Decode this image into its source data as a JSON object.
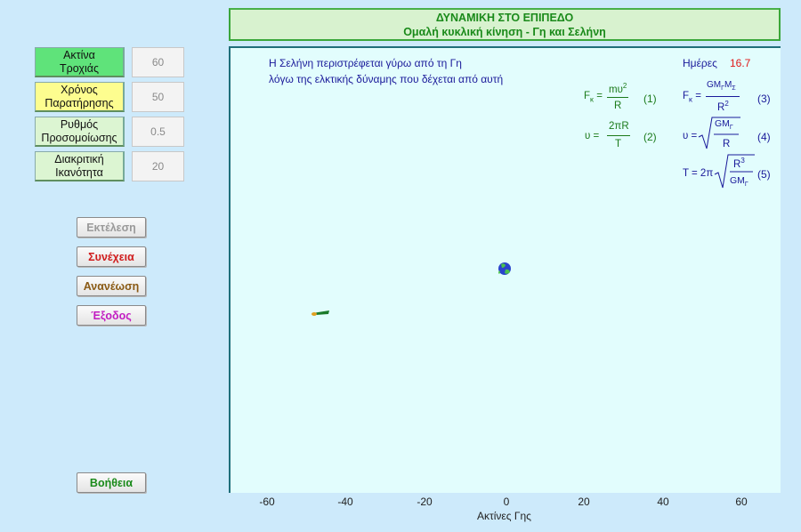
{
  "parameters": [
    {
      "label_line1": "Ακτίνα",
      "label_line2": "Τροχιάς",
      "value": "60",
      "color": "#5fe37a"
    },
    {
      "label_line1": "Χρόνος",
      "label_line2": "Παρατήρησης",
      "value": "50",
      "color": "#fdfd8f"
    },
    {
      "label_line1": "Ρυθμός",
      "label_line2": "Προσομοίωσης",
      "value": "0.5",
      "color": "#dcf5d2"
    },
    {
      "label_line1": "Διακριτική",
      "label_line2": "Ικανότητα",
      "value": "20",
      "color": "#dcf5d2"
    }
  ],
  "buttons": {
    "run": {
      "label": "Εκτέλεση",
      "color": "#9a9a9a",
      "state": "disabled"
    },
    "continue": {
      "label": "Συνέχεια",
      "color": "#d01c1c"
    },
    "refresh": {
      "label": "Ανανέωση",
      "color": "#8a5a14"
    },
    "exit": {
      "label": "Έξοδος",
      "color": "#c21cc2"
    },
    "help": {
      "label": "Βοήθεια",
      "color": "#1a8a1a"
    }
  },
  "header": {
    "title": "ΔΥΝΑΜΙΚΗ ΣΤΟ ΕΠΙΠΕΔΟ",
    "subtitle": "Ομαλή κυκλική κίνηση  - Γη και Σελήνη"
  },
  "description": {
    "line1": "Η Σελήνη περιστρέφεται γύρω από τη Γη",
    "line2": "λόγω της ελκτικής δύναμης που δέχεται από αυτή"
  },
  "days": {
    "label": "Ημέρες",
    "value": "16.7"
  },
  "equations": {
    "eq1": {
      "lhs": "F",
      "lhs_sub": "κ",
      "num": "mυ",
      "num_sup": "2",
      "den": "R",
      "number": "(1)"
    },
    "eq2": {
      "lhs": "υ",
      "num": "2πR",
      "den": "T",
      "number": "(2)"
    },
    "eq3": {
      "lhs": "F",
      "lhs_sub": "κ",
      "num": "GM",
      "num_sub1": "Γ",
      "num_mid": "M",
      "num_sub2": "Σ",
      "den": "R",
      "den_sup": "2",
      "number": "(3)"
    },
    "eq4": {
      "lhs": "υ",
      "num": "GM",
      "num_sub": "Γ",
      "den": "R",
      "number": "(4)"
    },
    "eq5": {
      "lhs": "T = 2π",
      "num": "R",
      "num_sup": "3",
      "den": "GM",
      "den_sub": "Γ",
      "number": "(5)"
    }
  },
  "axis": {
    "label": "Ακτίνες Γης",
    "ticks": [
      "-60",
      "-40",
      "-20",
      "0",
      "20",
      "40",
      "60"
    ]
  },
  "bodies": {
    "earth": {
      "x": 0,
      "y": 0,
      "icon": "earth-icon"
    },
    "moon": {
      "x": -47,
      "y": -11,
      "icon": "moon-icon"
    }
  }
}
